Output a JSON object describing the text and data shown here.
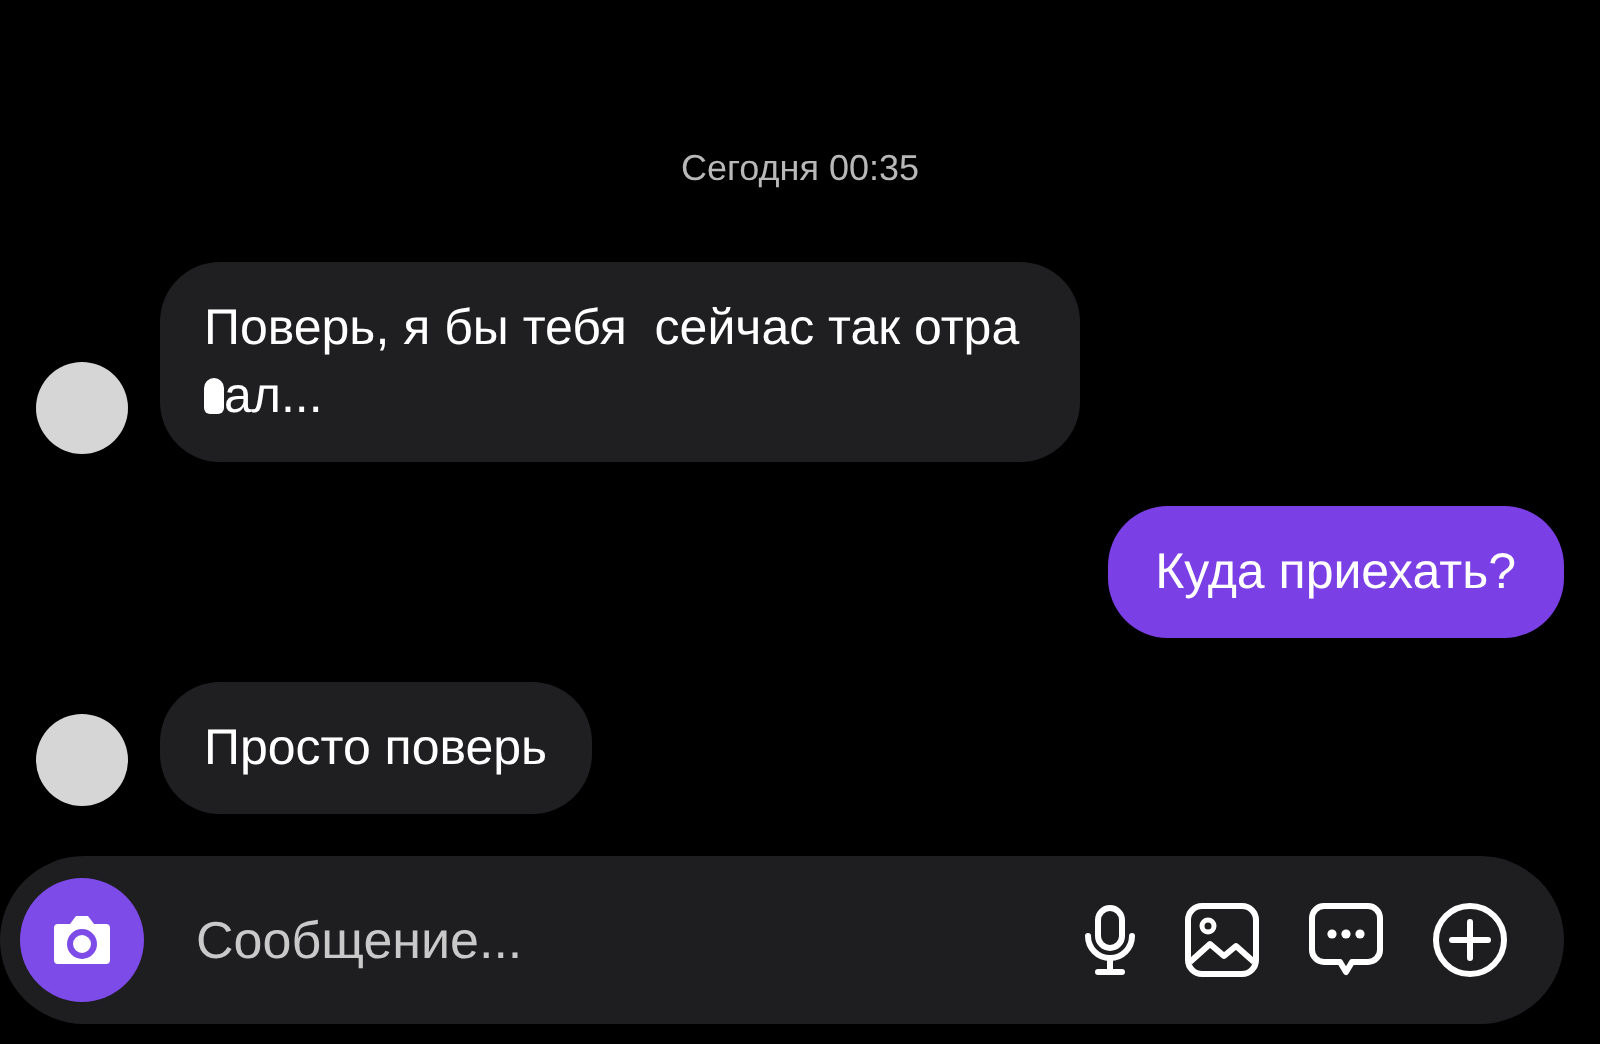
{
  "timestamp": "Сегодня 00:35",
  "messages": [
    {
      "kind": "incoming",
      "parts": [
        "Поверь, я бы тебя  сейчас так отра",
        "ал..."
      ]
    },
    {
      "kind": "outgoing",
      "parts": [
        "Куда приехать?"
      ]
    },
    {
      "kind": "incoming",
      "parts": [
        "Просто поверь"
      ]
    }
  ],
  "composer": {
    "placeholder": "Сообщение..."
  }
}
